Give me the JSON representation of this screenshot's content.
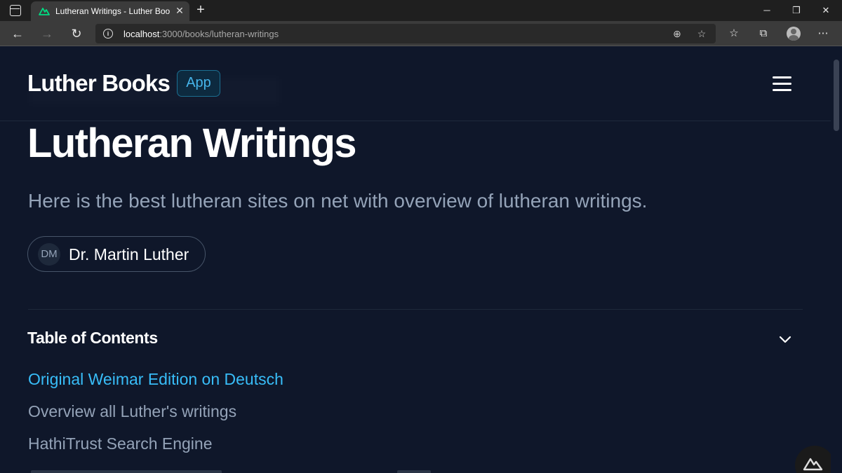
{
  "browser": {
    "tab_title": "Lutheran Writings - Luther Books",
    "url_host": "localhost",
    "url_path": ":3000/books/lutheran-writings"
  },
  "header": {
    "brand": "Luther Books",
    "badge": "App"
  },
  "page": {
    "title": "Lutheran Writings",
    "description": "Here is the best lutheran sites on net with overview of lutheran writings.",
    "author": {
      "initials": "DM",
      "name": "Dr. Martin Luther"
    }
  },
  "toc": {
    "heading": "Table of Contents",
    "items": [
      {
        "label": "Original Weimar Edition on Deutsch",
        "active": true
      },
      {
        "label": "Overview all Luther's writings",
        "active": false
      },
      {
        "label": "HathiTrust Search Engine",
        "active": false
      }
    ]
  },
  "colors": {
    "background": "#0f172a",
    "accent": "#38bdf8",
    "muted_text": "#94a3b8",
    "nuxt_green": "#00dc82"
  },
  "icons": {
    "tab_favicon": "nuxt-logo-icon",
    "menu": "hamburger-menu-icon",
    "toc_toggle": "chevron-down-icon",
    "floating": "nuxt-devtools-icon"
  }
}
